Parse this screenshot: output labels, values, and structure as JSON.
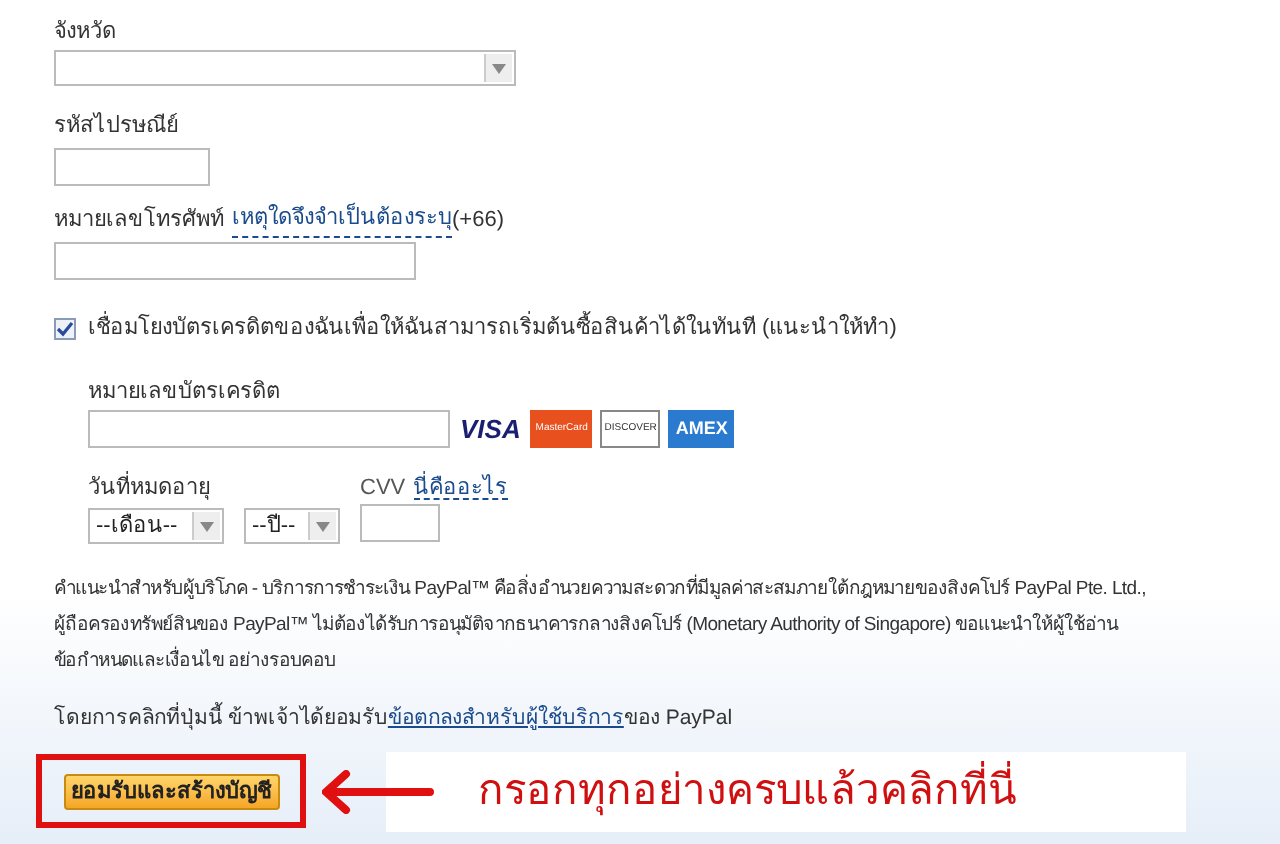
{
  "province": {
    "label": "จังหวัด"
  },
  "postal_code": {
    "label": "รหัสไปรษณีย์"
  },
  "phone": {
    "label": "หมายเลขโทรศัพท์",
    "link": "เหตุใดจึงจำเป็นต้องระบุ",
    "suffix": "(+66)"
  },
  "link_card": {
    "label": "เชื่อมโยงบัตรเครดิตของฉันเพื่อให้ฉันสามารถเริ่มต้นซื้อสินค้าได้ในทันที (แนะนำให้ทำ)",
    "checked": true
  },
  "card_number": {
    "label": "หมายเลขบัตรเครดิต"
  },
  "card_logos": [
    {
      "kind": "visa",
      "text": "VISA"
    },
    {
      "kind": "mastercard",
      "text": "MasterCard"
    },
    {
      "kind": "discover",
      "text": "DISCOVER"
    },
    {
      "kind": "amex",
      "text": "AMEX"
    }
  ],
  "expiry": {
    "label": "วันที่หมดอายุ",
    "month": "--เดือน--",
    "year": "--ปี--"
  },
  "cvv": {
    "label": "CVV",
    "link": "นี่คืออะไร"
  },
  "notice": [
    "คำแนะนำสำหรับผู้บริโภค - บริการการชำระเงิน PayPal™ คือสิ่งอำนวยความสะดวกที่มีมูลค่าสะสมภายใต้กฎหมายของสิงคโปร์ PayPal Pte. Ltd.,",
    "ผู้ถือครองทรัพย์สินของ PayPal™ ไม่ต้องได้รับการอนุมัติจากธนาคารกลางสิงคโปร์ (Monetary Authority of Singapore) ขอแนะนำให้ผู้ใช้อ่าน",
    "ข้อกำหนดและเงื่อนไข อย่างรอบคอบ"
  ],
  "agreement": {
    "before": "โดยการคลิกที่ปุ่มนี้ ข้าพเจ้าได้ยอมรับ",
    "link": "ข้อตกลงสำหรับผู้ใช้บริการ",
    "after": "ของ PayPal"
  },
  "submit_button": "ยอมรับและสร้างบัญชี",
  "annotation": "กรอกทุกอย่างครบแล้วคลิกที่นี่"
}
